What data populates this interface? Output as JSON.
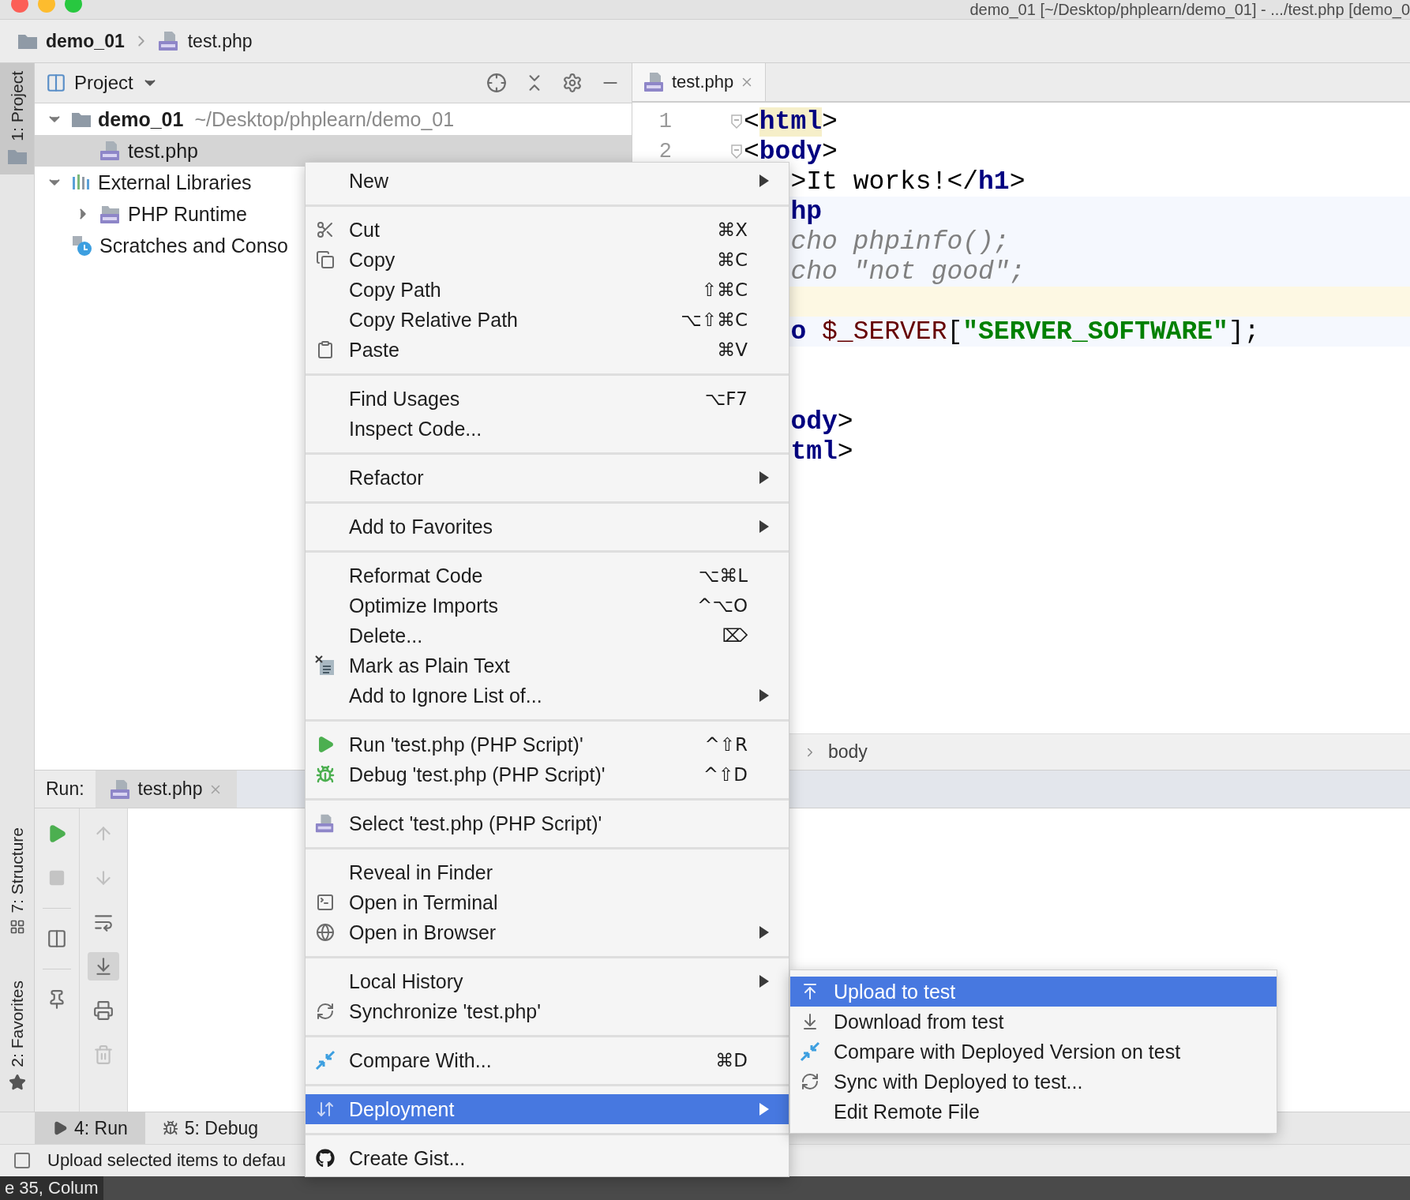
{
  "window": {
    "title": "demo_01 [~/Desktop/phplearn/demo_01] - .../test.php [demo_0"
  },
  "navigation": [
    {
      "label": "demo_01",
      "kind": "folder"
    },
    {
      "label": "test.php",
      "kind": "php"
    }
  ],
  "tool_stripe": [
    {
      "label": "1: Project",
      "kind": "project",
      "selected": true
    },
    {
      "label": "7: Structure",
      "kind": "structure",
      "selected": false
    },
    {
      "label": "2: Favorites",
      "kind": "favorites",
      "selected": false
    }
  ],
  "project_panel": {
    "title": "Project",
    "tree": [
      {
        "label": "demo_01",
        "path": "~/Desktop/phplearn/demo_01",
        "kind": "folder",
        "expanded": true,
        "selected": false,
        "children": [
          {
            "label": "test.php",
            "kind": "php",
            "selected": true
          }
        ]
      },
      {
        "label": "External Libraries",
        "kind": "library",
        "expanded": true,
        "selected": false,
        "children": [
          {
            "label": "PHP Runtime",
            "kind": "phpfolder",
            "expanded": false,
            "selected": false
          }
        ]
      },
      {
        "label": "Scratches and Conso",
        "kind": "scratch",
        "selected": false
      }
    ]
  },
  "editor": {
    "tabs": [
      {
        "label": "test.php",
        "selected": true
      }
    ],
    "lines": [
      {
        "number": "1",
        "kind": "plain",
        "segments": [
          {
            "text": "<",
            "kind": "punct"
          },
          {
            "text": "html",
            "kind": "tag_match"
          },
          {
            "text": ">",
            "kind": "punct"
          }
        ]
      },
      {
        "number": "2",
        "kind": "plain",
        "segments": [
          {
            "text": "<",
            "kind": "punct"
          },
          {
            "text": "body",
            "kind": "tag"
          },
          {
            "text": ">",
            "kind": "punct"
          }
        ]
      },
      {
        "kind": "plain",
        "segments": [
          {
            "text": ">",
            "kind": "punct"
          },
          {
            "text": "It works!",
            "kind": "text"
          },
          {
            "text": "</",
            "kind": "punct"
          },
          {
            "text": "h1",
            "kind": "tag"
          },
          {
            "text": ">",
            "kind": "punct"
          }
        ]
      },
      {
        "kind": "injected",
        "segments": [
          {
            "text": "hp",
            "kind": "tag"
          }
        ]
      },
      {
        "kind": "injected",
        "segments": [
          {
            "text": "cho phpinfo();",
            "kind": "comment"
          }
        ]
      },
      {
        "kind": "injected",
        "segments": [
          {
            "text": "cho \"not good\";",
            "kind": "comment"
          }
        ]
      },
      {
        "kind": "caret"
      },
      {
        "kind": "injected",
        "segments": [
          {
            "text": "o",
            "kind": "tag"
          },
          {
            "text": " $_SERVER",
            "kind": "variable"
          },
          {
            "text": "[",
            "kind": "punct"
          },
          {
            "text": "\"SERVER_SOFTWARE\"",
            "kind": "string"
          },
          {
            "text": "];",
            "kind": "punct"
          }
        ]
      },
      {
        "kind": "plain"
      },
      {
        "kind": "plain"
      },
      {
        "kind": "plain",
        "segments": [
          {
            "text": "ody",
            "kind": "tag"
          },
          {
            "text": ">",
            "kind": "punct"
          }
        ]
      },
      {
        "kind": "plain",
        "segments": [
          {
            "text": "tml",
            "kind": "tag"
          },
          {
            "text": ">",
            "kind": "punct"
          }
        ]
      }
    ],
    "breadcrumb": "body"
  },
  "run_panel": {
    "title": "Run:",
    "tabs": [
      {
        "label": "test.php",
        "selected": true
      }
    ]
  },
  "bottom_bar": [
    {
      "label": "4: Run",
      "kind": "run",
      "selected": true
    },
    {
      "label": "5: Debug",
      "kind": "debug",
      "selected": false
    }
  ],
  "status_bar": {
    "text": "Upload selected items to defau"
  },
  "position_label": "e 35, Colum",
  "context_menu": {
    "groups": [
      [
        {
          "label": "New",
          "submenu": true,
          "selected": false
        }
      ],
      [
        {
          "label": "Cut",
          "shortcut": "⌘X",
          "submenu": false,
          "selected": false
        },
        {
          "label": "Copy",
          "shortcut": "⌘C",
          "submenu": false,
          "selected": false
        },
        {
          "label": "Copy Path",
          "shortcut": "⇧⌘C",
          "submenu": false,
          "selected": false
        },
        {
          "label": "Copy Relative Path",
          "shortcut": "⌥⇧⌘C",
          "submenu": false,
          "selected": false
        },
        {
          "label": "Paste",
          "shortcut": "⌘V",
          "submenu": false,
          "selected": false
        }
      ],
      [
        {
          "label": "Find Usages",
          "shortcut": "⌥F7",
          "submenu": false,
          "selected": false
        },
        {
          "label": "Inspect Code...",
          "submenu": false,
          "selected": false
        }
      ],
      [
        {
          "label": "Refactor",
          "submenu": true,
          "selected": false
        }
      ],
      [
        {
          "label": "Add to Favorites",
          "submenu": true,
          "selected": false
        }
      ],
      [
        {
          "label": "Reformat Code",
          "shortcut": "⌥⌘L",
          "submenu": false,
          "selected": false
        },
        {
          "label": "Optimize Imports",
          "shortcut": "^⌥O",
          "submenu": false,
          "selected": false
        },
        {
          "label": "Delete...",
          "shortcut": "⌦",
          "submenu": false,
          "selected": false
        },
        {
          "label": "Mark as Plain Text",
          "submenu": false,
          "selected": false
        },
        {
          "label": "Add to Ignore List of...",
          "submenu": true,
          "selected": false
        }
      ],
      [
        {
          "label": "Run 'test.php (PHP Script)'",
          "shortcut": "^⇧R",
          "submenu": false,
          "selected": false
        },
        {
          "label": "Debug 'test.php (PHP Script)'",
          "shortcut": "^⇧D",
          "submenu": false,
          "selected": false
        }
      ],
      [
        {
          "label": "Select 'test.php (PHP Script)'",
          "submenu": false,
          "selected": false
        }
      ],
      [
        {
          "label": "Reveal in Finder",
          "submenu": false,
          "selected": false
        },
        {
          "label": "Open in Terminal",
          "submenu": false,
          "selected": false
        },
        {
          "label": "Open in Browser",
          "submenu": true,
          "selected": false
        }
      ],
      [
        {
          "label": "Local History",
          "submenu": true,
          "selected": false
        },
        {
          "label": "Synchronize 'test.php'",
          "submenu": false,
          "selected": false
        }
      ],
      [
        {
          "label": "Compare With...",
          "shortcut": "⌘D",
          "submenu": false,
          "selected": false
        }
      ],
      [
        {
          "label": "Deployment",
          "submenu": true,
          "selected": true
        }
      ],
      [
        {
          "label": "Create Gist...",
          "submenu": false,
          "selected": false
        }
      ]
    ]
  },
  "submenu": {
    "items": [
      {
        "label": "Upload to test",
        "selected": true
      },
      {
        "label": "Download from test",
        "selected": false
      },
      {
        "label": "Compare with Deployed Version on test",
        "selected": false
      },
      {
        "label": "Sync with Deployed to test...",
        "selected": false
      },
      {
        "label": "Edit Remote File",
        "selected": false
      }
    ]
  }
}
